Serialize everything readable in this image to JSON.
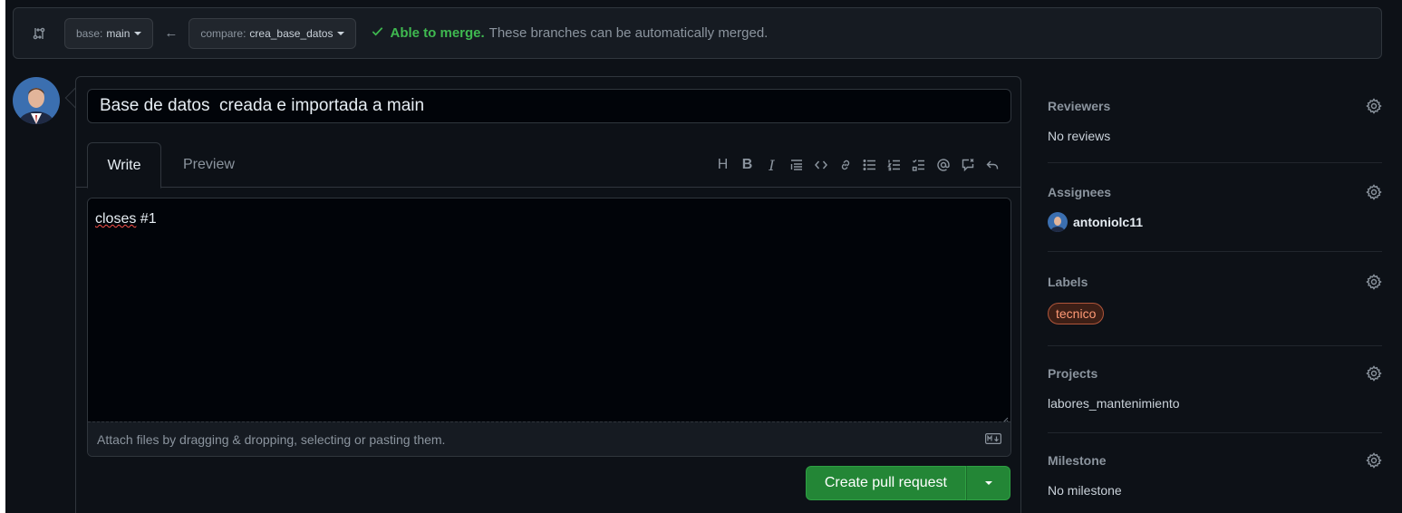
{
  "compare_bar": {
    "icon": "git-compare-icon",
    "base_prefix": "base:",
    "base_branch": "main",
    "arrow_icon": "arrow-left-icon",
    "compare_prefix": "compare:",
    "compare_branch": "crea_base_datos",
    "status_icon": "check-icon",
    "status_strong": "Able to merge.",
    "status_text": "These branches can be automatically merged.",
    "status_color": "#3fb950"
  },
  "composer": {
    "title_value": "Base de datos  creada e importada a main",
    "tabs": [
      {
        "label": "Write",
        "active": true
      },
      {
        "label": "Preview",
        "active": false
      }
    ],
    "toolbar": [
      "heading-icon",
      "bold-icon",
      "italic-icon",
      "quote-icon",
      "code-icon",
      "link-icon",
      "unordered-list-icon",
      "ordered-list-icon",
      "task-list-icon",
      "mention-icon",
      "cross-reference-icon",
      "reply-icon"
    ],
    "body_word_misspelled": "closes",
    "body_rest": " #1",
    "attach_hint": "Attach files by dragging & dropping, selecting or pasting them.",
    "markdown_icon": "markdown-icon",
    "create_button": "Create pull request",
    "primary_color": "#238636"
  },
  "sidebar": {
    "reviewers": {
      "title": "Reviewers",
      "value": "No reviews"
    },
    "assignees": {
      "title": "Assignees",
      "user": "antoniolc11"
    },
    "labels": {
      "title": "Labels",
      "items": [
        "tecnico"
      ],
      "label_color": "#b0553a"
    },
    "projects": {
      "title": "Projects",
      "value": "labores_mantenimiento"
    },
    "milestone": {
      "title": "Milestone",
      "value": "No milestone"
    }
  }
}
